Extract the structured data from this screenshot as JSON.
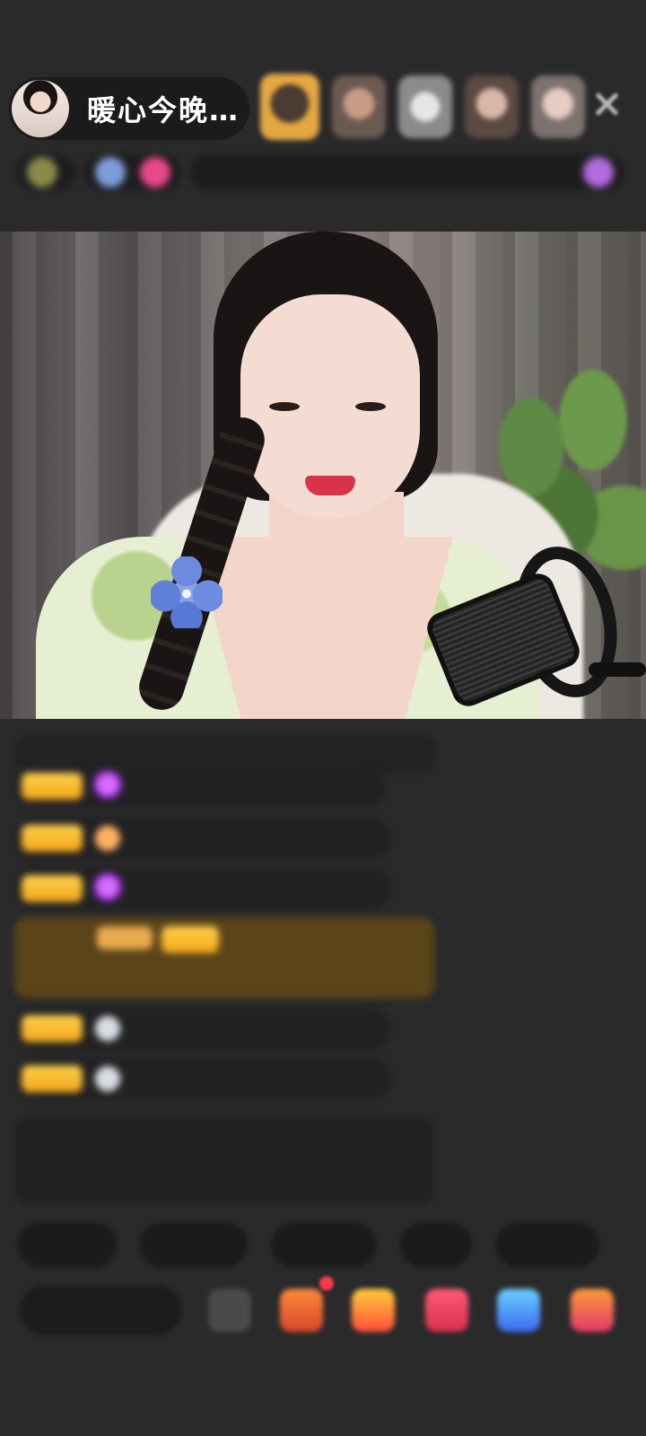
{
  "header": {
    "host_name": "暖心今晚…",
    "viewers": [
      "viewer-1",
      "viewer-2",
      "viewer-3",
      "viewer-4",
      "viewer-5"
    ],
    "close_icon": "close-icon"
  },
  "info_bar": {
    "chips": [
      "",
      "",
      ""
    ]
  },
  "chat": {
    "welcome": "",
    "messages": [
      {
        "badge": "level-badge",
        "icon": "gem-icon",
        "user": "",
        "text": ""
      },
      {
        "badge": "level-badge",
        "icon": "orange-icon",
        "user": "",
        "text": ""
      },
      {
        "badge": "level-badge",
        "icon": "gem-icon",
        "user": "",
        "text": ""
      },
      {
        "badge": "level-badge",
        "icon": "silver-icon",
        "user": "",
        "text": ""
      },
      {
        "badge": "level-badge",
        "icon": "silver-icon",
        "user": "",
        "text": ""
      }
    ],
    "system_notice": ""
  },
  "quick_replies": [
    "",
    "",
    "",
    "",
    ""
  ],
  "input": {
    "placeholder": ""
  },
  "colors": {
    "background": "#2a2a2b",
    "badge": "#f2a71c",
    "system_text": "#9fcf6a",
    "gift_row": "#5a4418"
  }
}
